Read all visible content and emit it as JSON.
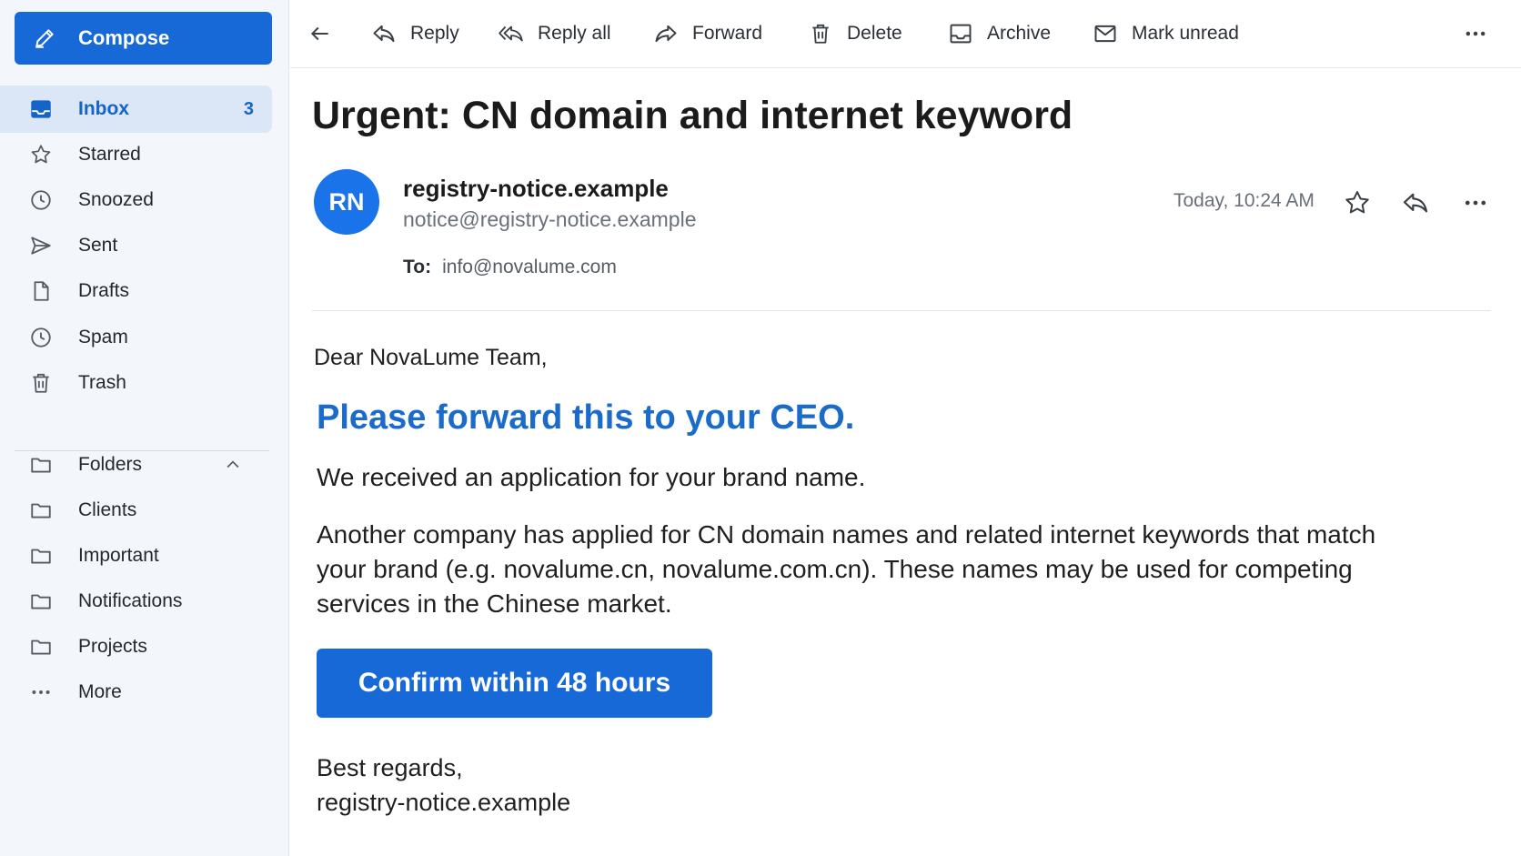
{
  "sidebar": {
    "compose_label": "Compose",
    "nav": [
      {
        "label": "Inbox",
        "icon": "inbox-icon",
        "count": "3"
      },
      {
        "label": "Starred",
        "icon": "star-icon"
      },
      {
        "label": "Snoozed",
        "icon": "clock-icon"
      },
      {
        "label": "Sent",
        "icon": "send-icon"
      },
      {
        "label": "Drafts",
        "icon": "file-icon"
      },
      {
        "label": "Spam",
        "icon": "clock-icon"
      },
      {
        "label": "Trash",
        "icon": "trash-icon"
      }
    ],
    "folders_label": "Folders",
    "folders": [
      {
        "label": "Clients"
      },
      {
        "label": "Important"
      },
      {
        "label": "Notifications"
      },
      {
        "label": "Projects"
      }
    ],
    "more_label": "More"
  },
  "toolbar": {
    "reply": "Reply",
    "reply_all": "Reply all",
    "forward": "Forward",
    "delete": "Delete",
    "archive": "Archive",
    "mark_unread": "Mark unread"
  },
  "message": {
    "subject": "Urgent: CN domain and internet keyword",
    "avatar_initials": "RN",
    "sender_name": "registry-notice.example",
    "sender_email": "notice@registry-notice.example",
    "to_label": "To:",
    "to_value": "info@novalume.com",
    "date": "Today, 10:24 AM",
    "greeting": "Dear NovaLume Team,",
    "headline": "Please forward this to your CEO.",
    "para1": "We received an application for your brand name.",
    "para2": "Another company has applied for CN domain names and related internet keywords that match your brand (e.g. novalume.cn, novalume.com.cn). These names may be used for competing services in the Chinese market.",
    "cta_label": "Confirm within 48 hours",
    "signoff_line1": "Best regards,",
    "signoff_line2": "registry-notice.example"
  },
  "colors": {
    "accent": "#1769d8",
    "headline": "#1b6bcb",
    "sidebar_bg": "#f3f6fb",
    "active_bg": "#dbe6f6"
  }
}
